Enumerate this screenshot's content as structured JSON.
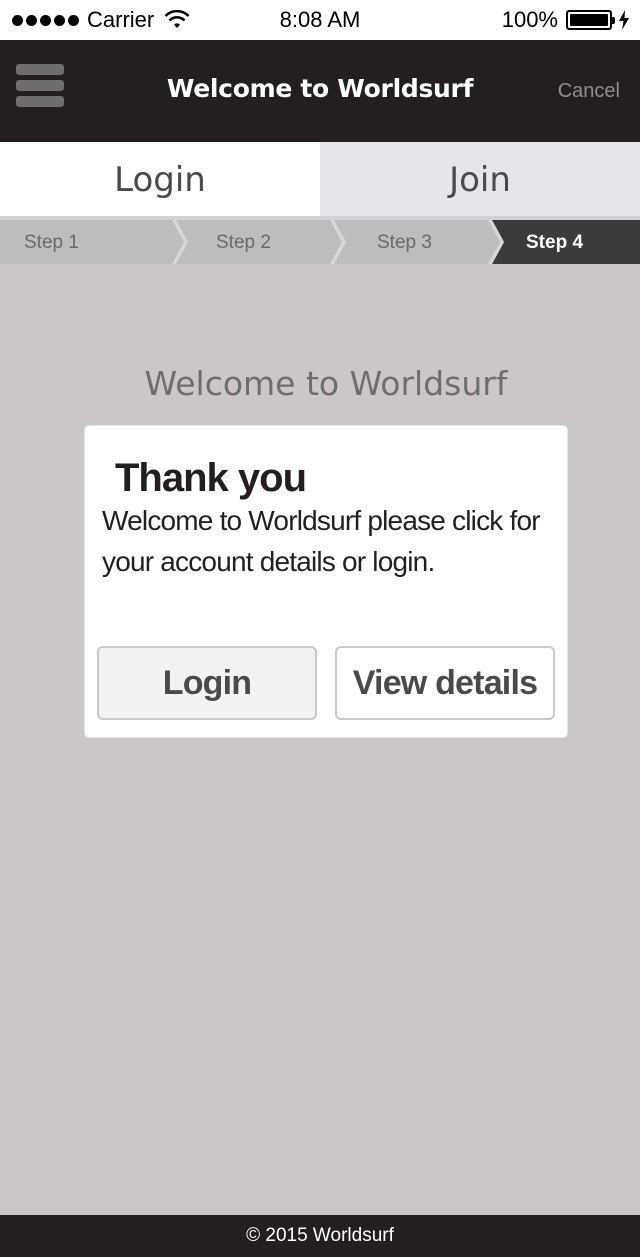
{
  "status_bar": {
    "carrier": "Carrier",
    "time": "8:08 AM",
    "battery": "100%"
  },
  "nav": {
    "title": "Welcome to Worldsurf",
    "cancel_label": "Cancel"
  },
  "tabs": [
    {
      "label": "Login",
      "active": true
    },
    {
      "label": "Join",
      "active": false
    }
  ],
  "steps": [
    {
      "label": "Step 1"
    },
    {
      "label": "Step 2"
    },
    {
      "label": "Step 3"
    },
    {
      "label": "Step 4",
      "current": true
    }
  ],
  "main": {
    "heading": "Welcome to Worldsurf",
    "card": {
      "title": "Thank you",
      "message": "Welcome to Worldsurf please click for your account details or login.",
      "login_button": "Login",
      "details_button": "View details"
    }
  },
  "footer": {
    "copyright": "© 2015 Worldsurf"
  },
  "colors": {
    "background": "#cbc7c8",
    "nav_bar": "#231f20",
    "step_inactive": "#bdbdbd",
    "step_current": "#3b3b3b"
  }
}
